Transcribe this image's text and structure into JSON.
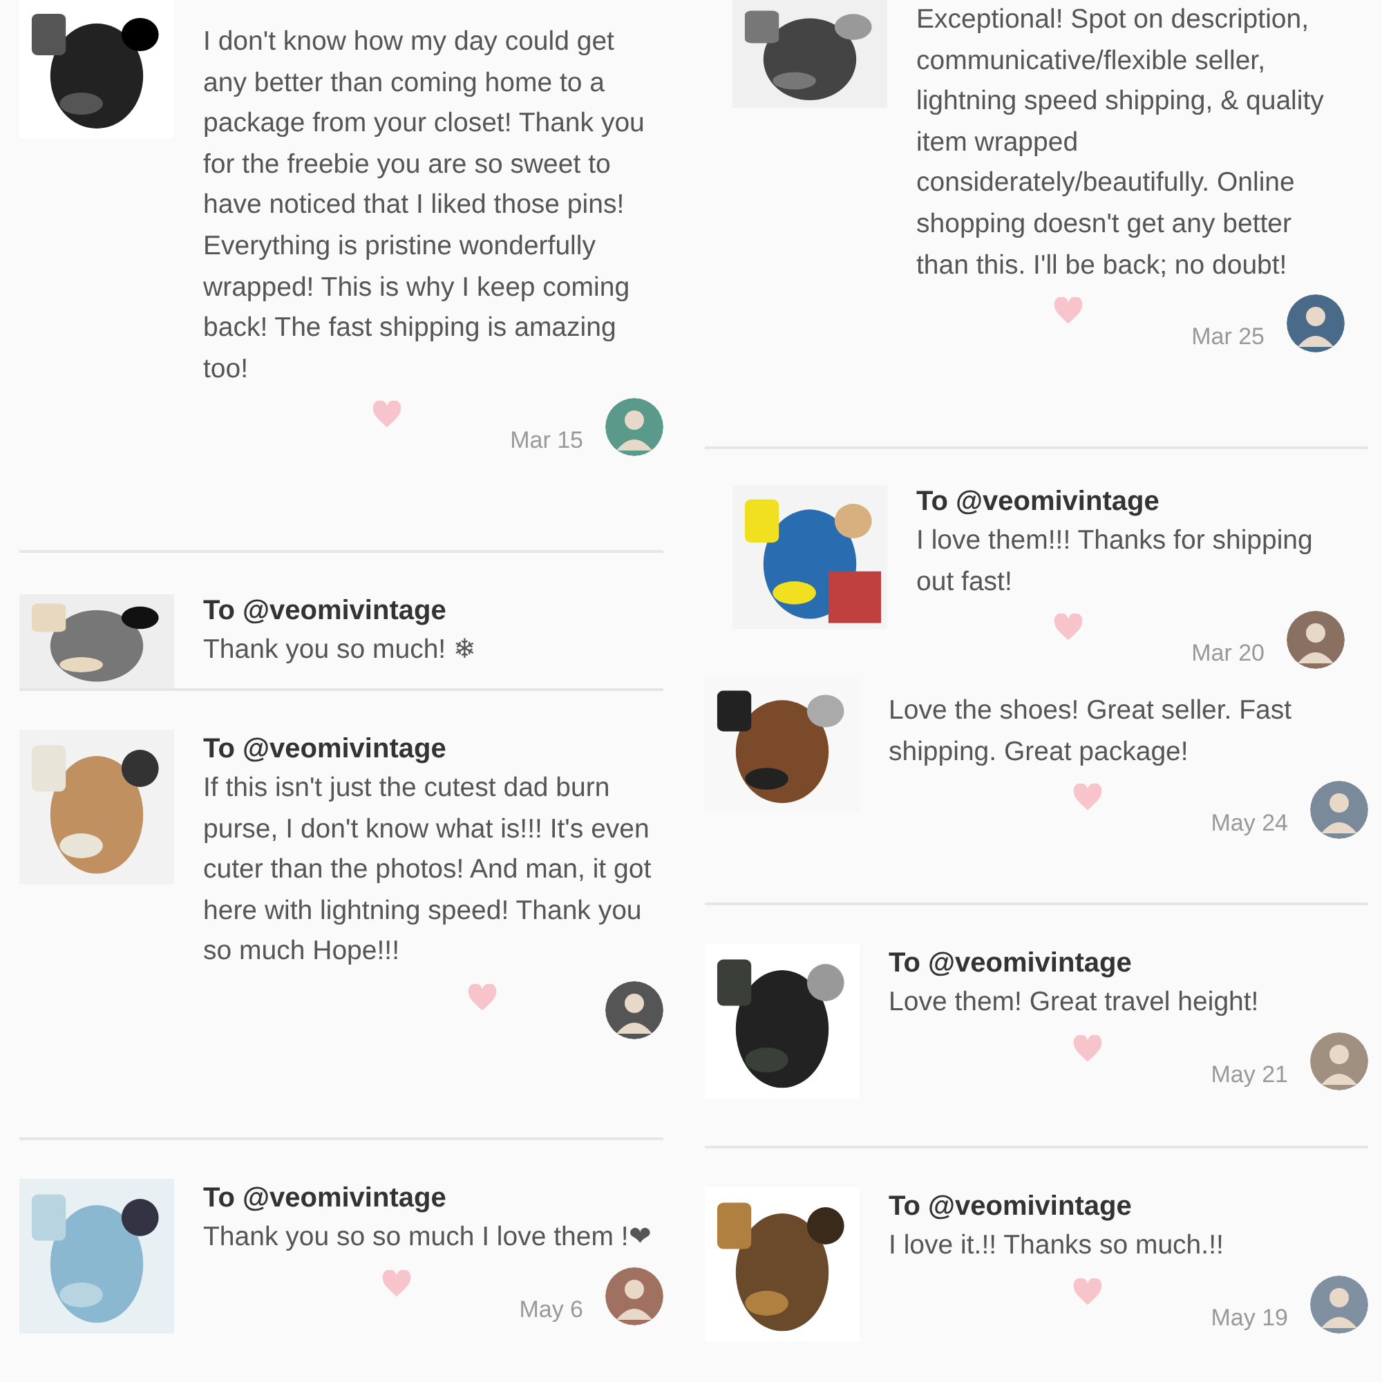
{
  "columns": [
    {
      "reviews": [
        {
          "body": "I don't know how my day could get any better than coming home to a package from your closet! Thank you for the freebie you are so sweet to have noticed that I liked those pins! Everything is pristine wonderfully wrapped! This is why I keep coming back! The fast shipping is amazing too!",
          "date": "Mar 15"
        },
        {
          "to": "To @veomivintage",
          "body": "Thank you so much! ❄"
        },
        {
          "to": "To @veomivintage",
          "body": "If this isn't just the cutest dad burn purse, I don't know what is!!! It's even cuter than the photos! And man, it got here with lightning speed! Thank you so much Hope!!!"
        },
        {
          "to": "To @veomivintage",
          "body": "Thank you so so much I love them !❤",
          "date": "May 6"
        }
      ]
    },
    {
      "reviews": [
        {
          "body": "Exceptional! Spot on description, communicative/flexible seller, lightning speed shipping, & quality item wrapped considerately/beautifully. Online shopping doesn't get any better than this. I'll be back; no doubt!",
          "date": "Mar 25"
        },
        {
          "to": "To @veomivintage",
          "body": "I love them!!! Thanks for shipping out fast!",
          "date": "Mar 20"
        },
        {
          "body": "Love the shoes! Great seller. Fast shipping. Great package!",
          "date": "May 24"
        },
        {
          "to": "To @veomivintage",
          "body": "Love them! Great travel height!",
          "date": "May 21"
        },
        {
          "to": "To @veomivintage",
          "body": "I love it.!! Thanks so much.!!",
          "date": "May 19"
        }
      ]
    }
  ]
}
